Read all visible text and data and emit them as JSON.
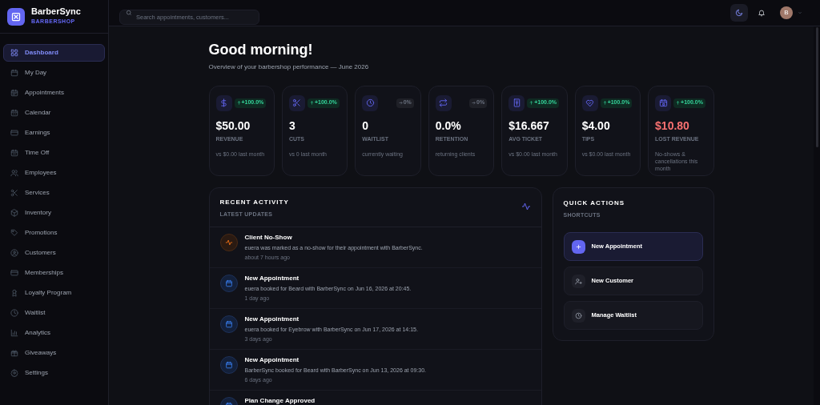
{
  "brand": {
    "name": "BarberSync",
    "subtitle": "BARBERSHOP"
  },
  "sidebar": {
    "items": [
      {
        "label": "Dashboard",
        "selected": true
      },
      {
        "label": "My Day",
        "selected": false
      },
      {
        "label": "Appointments",
        "selected": false
      },
      {
        "label": "Calendar",
        "selected": false
      },
      {
        "label": "Earnings",
        "selected": false
      },
      {
        "label": "Time Off",
        "selected": false
      },
      {
        "label": "Employees",
        "selected": false
      },
      {
        "label": "Services",
        "selected": false
      },
      {
        "label": "Inventory",
        "selected": false
      },
      {
        "label": "Promotions",
        "selected": false
      },
      {
        "label": "Customers",
        "selected": false
      },
      {
        "label": "Memberships",
        "selected": false
      },
      {
        "label": "Loyalty Program",
        "selected": false
      },
      {
        "label": "Waitlist",
        "selected": false
      },
      {
        "label": "Analytics",
        "selected": false
      },
      {
        "label": "Giveaways",
        "selected": false
      },
      {
        "label": "Settings",
        "selected": false
      }
    ]
  },
  "topbar": {
    "search": {
      "placeholder": "Search appointments, customers..."
    },
    "avatar": "B"
  },
  "header": {
    "title": "Good morning!",
    "subtitle": "Overview of your barbershop performance — June 2026"
  },
  "stats": [
    {
      "value": "$50.00",
      "label": "REVENUE",
      "note": "vs $0.00 last month",
      "rising": true,
      "change": "+100.0%",
      "alert": false
    },
    {
      "value": "3",
      "label": "CUTS",
      "note": "vs 0 last month",
      "rising": true,
      "change": "+100.0%",
      "alert": false
    },
    {
      "value": "0",
      "label": "WAITLIST",
      "note": "currently waiting",
      "rising": false,
      "change": "0%",
      "alert": false
    },
    {
      "value": "0.0%",
      "label": "RETENTION",
      "note": "returning clients",
      "rising": false,
      "change": "0%",
      "alert": false
    },
    {
      "value": "$16.667",
      "label": "AVG TICKET",
      "note": "vs $0.00 last month",
      "rising": true,
      "change": "+100.0%",
      "alert": false
    },
    {
      "value": "$4.00",
      "label": "TIPS",
      "note": "vs $0.00 last month",
      "rising": true,
      "change": "+100.0%",
      "alert": false
    },
    {
      "value": "$10.80",
      "label": "LOST REVENUE",
      "note": "No-shows & cancellations this month",
      "rising": true,
      "change": "+100.0%",
      "alert": true
    }
  ],
  "activity": {
    "title": "RECENT ACTIVITY",
    "subtitle": "LATEST UPDATES",
    "items": [
      {
        "kind": "no-show",
        "title": "Client No-Show",
        "text": "euera was marked as a no-show for their appointment with BarberSync.",
        "time": "about 7 hours ago"
      },
      {
        "kind": "appointment",
        "title": "New Appointment",
        "text": "euera booked for Beard with BarberSync on Jun 16, 2026 at 20:45.",
        "time": "1 day ago"
      },
      {
        "kind": "appointment",
        "title": "New Appointment",
        "text": "euera booked for Eyebrow with BarberSync on Jun 17, 2026 at 14:15.",
        "time": "3 days ago"
      },
      {
        "kind": "appointment",
        "title": "New Appointment",
        "text": "BarberSync booked for Beard with BarberSync on Jun 13, 2026 at 09:30.",
        "time": "6 days ago"
      },
      {
        "kind": "appointment",
        "title": "Plan Change Approved"
      }
    ]
  },
  "quick_actions": {
    "title": "QUICK ACTIONS",
    "subtitle": "SHORTCUTS",
    "items": [
      {
        "label": "New Appointment",
        "primary": true
      },
      {
        "label": "New Customer",
        "primary": false
      },
      {
        "label": "Manage Waitlist",
        "primary": false
      }
    ]
  }
}
